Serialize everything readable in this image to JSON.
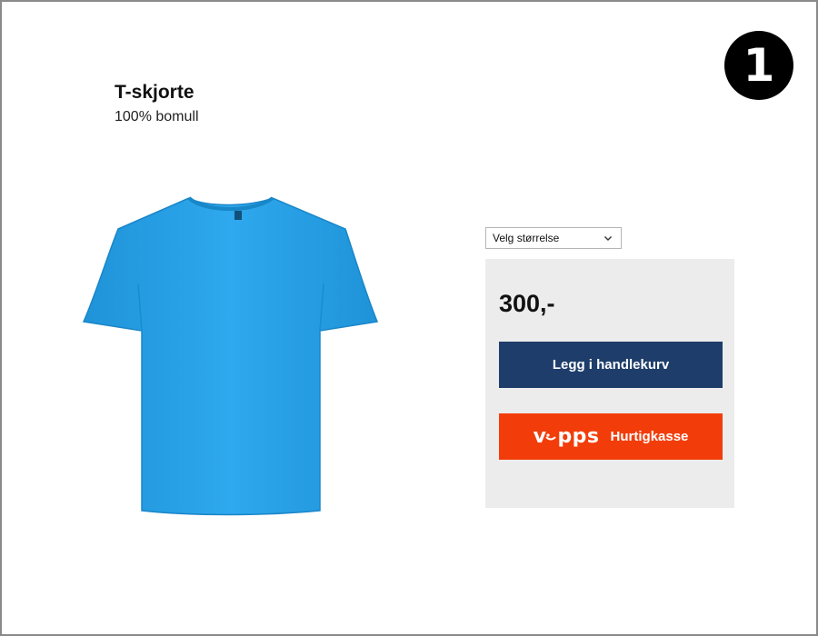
{
  "step": {
    "number": "1"
  },
  "product": {
    "title": "T-skjorte",
    "subtitle": "100% bomull",
    "image_icon": "t-shirt-icon",
    "shirt_color": "#2aa3e8"
  },
  "size_select": {
    "selected": "Velg størrelse",
    "icon": "chevron-down-icon"
  },
  "buy_panel": {
    "price": "300,-",
    "cart_button_label": "Legg i handlekurv",
    "vipps": {
      "logo_text": "vipps",
      "logo_prefix": "v",
      "logo_suffix": "pps",
      "label": "Hurtigkasse",
      "color": "#f23d0a"
    },
    "cart_button_color": "#1e3d6b"
  }
}
